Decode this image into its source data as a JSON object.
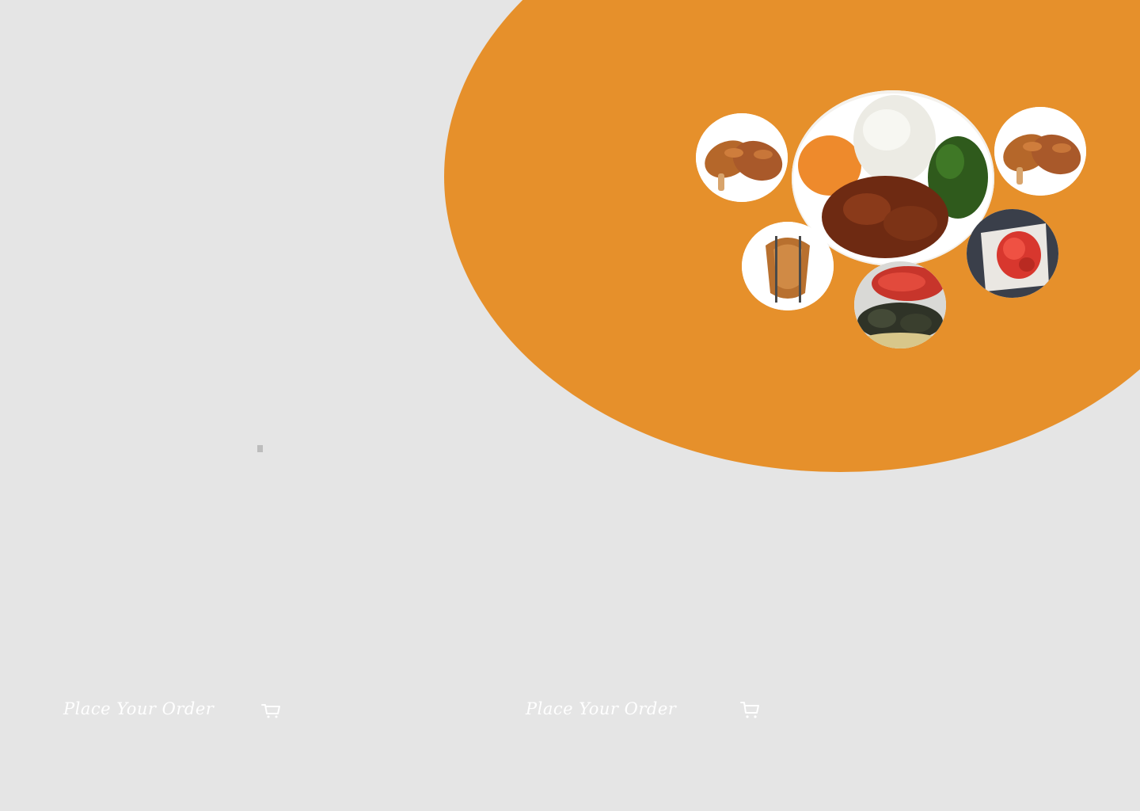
{
  "colors": {
    "background": "#e5e5e5",
    "accent": "#e6902b",
    "cta_text": "#ffffff"
  },
  "hero": {
    "images": [
      {
        "name": "chicken-drumsticks-left",
        "subject": "fried chicken drumsticks"
      },
      {
        "name": "ugali-plate",
        "subject": "ugali with beef stew, sukuma wiki and carrot salad"
      },
      {
        "name": "chicken-drumsticks-right",
        "subject": "fried chicken drumsticks"
      },
      {
        "name": "skewered-chicken",
        "subject": "roasted chicken on skewers"
      },
      {
        "name": "grilled-meat",
        "subject": "grilled meat with kachumbari"
      },
      {
        "name": "tomato-salad",
        "subject": "tomato kachumbari salad"
      }
    ]
  },
  "ctas": [
    {
      "label": "Place Your Order",
      "icon": "cart-icon"
    },
    {
      "label": "Place Your Order",
      "icon": "cart-icon"
    }
  ]
}
